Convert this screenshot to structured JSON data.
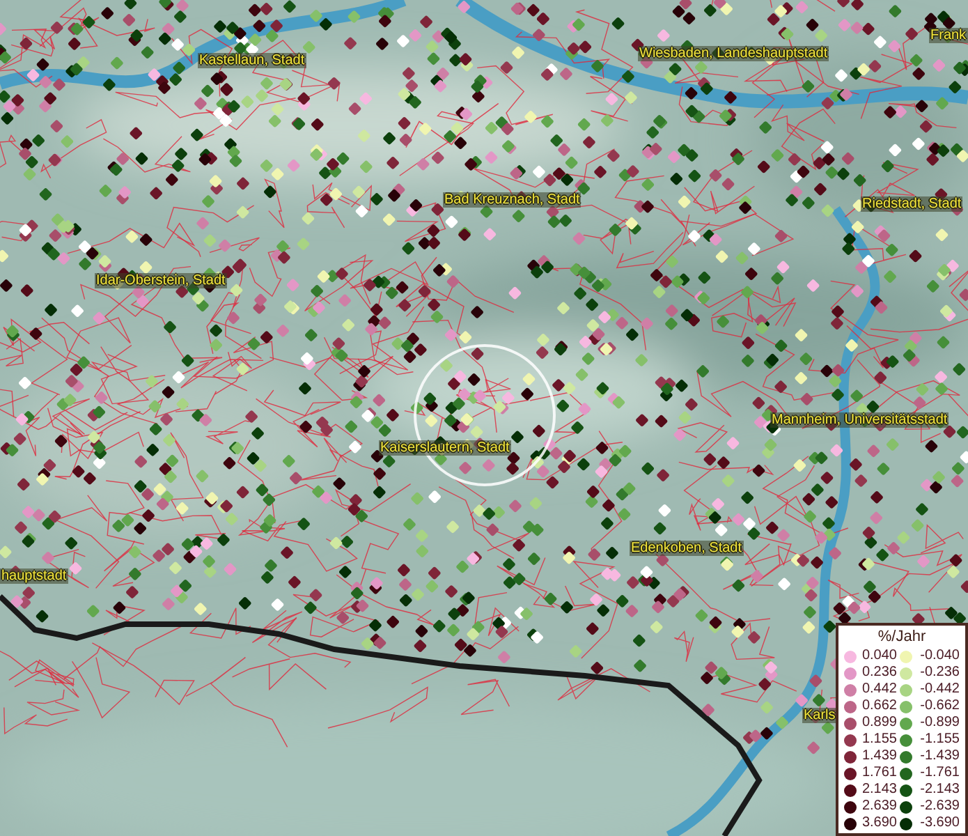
{
  "map": {
    "place_labels": [
      {
        "text": "Kastellaun, Stadt"
      },
      {
        "text": "Wiesbaden, Landeshauptstadt"
      },
      {
        "text": "Frank"
      },
      {
        "text": "Bad Kreuznach, Stadt"
      },
      {
        "text": "Riedstadt, Stadt"
      },
      {
        "text": "Idar-Oberstein, Stadt"
      },
      {
        "text": "Mannheim, Universitätsstadt"
      },
      {
        "text": "Kaiserslautern, Stadt"
      },
      {
        "text": "hauptstadt"
      },
      {
        "text": "Edenkoben, Stadt"
      },
      {
        "text": "Karls"
      }
    ]
  },
  "legend": {
    "title": "%/Jahr",
    "positive": [
      {
        "value": "0.040",
        "color": "#f7b8e0"
      },
      {
        "value": "0.236",
        "color": "#e397c6"
      },
      {
        "value": "0.442",
        "color": "#cf7fa6"
      },
      {
        "value": "0.662",
        "color": "#bd6688"
      },
      {
        "value": "0.899",
        "color": "#a84e6a"
      },
      {
        "value": "1.155",
        "color": "#94384f"
      },
      {
        "value": "1.439",
        "color": "#7f2539"
      },
      {
        "value": "1.761",
        "color": "#6a1527"
      },
      {
        "value": "2.143",
        "color": "#540b18"
      },
      {
        "value": "2.639",
        "color": "#3e050e"
      },
      {
        "value": "3.690",
        "color": "#280208"
      }
    ],
    "negative": [
      {
        "value": "-0.040",
        "color": "#f0f5b0"
      },
      {
        "value": "-0.236",
        "color": "#cfe8a0"
      },
      {
        "value": "-0.442",
        "color": "#a8d483"
      },
      {
        "value": "-0.662",
        "color": "#86c06a"
      },
      {
        "value": "-0.899",
        "color": "#62a84e"
      },
      {
        "value": "-1.155",
        "color": "#468f3a"
      },
      {
        "value": "-1.439",
        "color": "#337a2c"
      },
      {
        "value": "-1.761",
        "color": "#22661f"
      },
      {
        "value": "-2.143",
        "color": "#155314"
      },
      {
        "value": "-2.639",
        "color": "#0c400c"
      },
      {
        "value": "-3.690",
        "color": "#052e06"
      }
    ]
  }
}
